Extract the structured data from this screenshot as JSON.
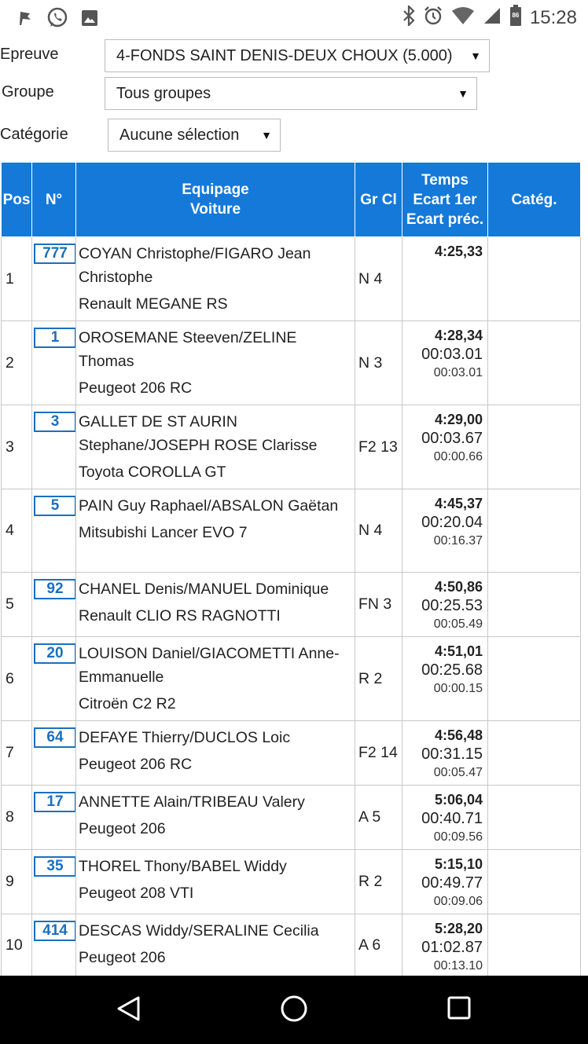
{
  "status_bar": {
    "time": "15:28",
    "battery": "86",
    "left_icons": [
      "flag-icon",
      "whatsapp-icon",
      "image-icon"
    ],
    "right_icons": [
      "bluetooth-icon",
      "alarm-icon",
      "wifi-icon",
      "signal-icon",
      "battery-icon"
    ]
  },
  "filters": {
    "epreuve": {
      "label": "Epreuve",
      "value": "4-FONDS SAINT DENIS-DEUX CHOUX (5.000)"
    },
    "groupe": {
      "label": "Groupe",
      "value": "Tous groupes"
    },
    "categorie": {
      "label": "Catégorie",
      "value": "Aucune sélection"
    }
  },
  "table": {
    "headers": {
      "pos": "Pos",
      "num": "N°",
      "equipage_line1": "Equipage",
      "equipage_line2": "Voiture",
      "grcl": "Gr Cl",
      "temps_line1": "Temps",
      "temps_line2": "Ecart 1er",
      "temps_line3": "Ecart préc.",
      "categ": "Catég."
    },
    "rows": [
      {
        "pos": "1",
        "num": "777",
        "crew": "COYAN Christophe/FIGARO Jean Christophe",
        "car": "Renault MEGANE RS",
        "grcl": "N 4",
        "time": "4:25,33",
        "gap_first": "",
        "gap_prev": "",
        "categ": ""
      },
      {
        "pos": "2",
        "num": "1",
        "crew": "OROSEMANE Steeven/ZELINE Thomas",
        "car": "Peugeot 206 RC",
        "grcl": "N 3",
        "time": "4:28,34",
        "gap_first": "00:03.01",
        "gap_prev": "00:03.01",
        "categ": ""
      },
      {
        "pos": "3",
        "num": "3",
        "crew": "GALLET DE ST AURIN Stephane/JOSEPH ROSE Clarisse",
        "car": "Toyota COROLLA GT",
        "grcl": "F2 13",
        "time": "4:29,00",
        "gap_first": "00:03.67",
        "gap_prev": "00:00.66",
        "categ": ""
      },
      {
        "pos": "4",
        "num": "5",
        "crew": "PAIN Guy Raphael/ABSALON Gaëtan",
        "car": "Mitsubishi Lancer EVO 7",
        "grcl": "N 4",
        "time": "4:45,37",
        "gap_first": "00:20.04",
        "gap_prev": "00:16.37",
        "categ": ""
      },
      {
        "pos": "5",
        "num": "92",
        "crew": "CHANEL Denis/MANUEL Dominique",
        "car": "Renault CLIO RS RAGNOTTI",
        "grcl": "FN 3",
        "time": "4:50,86",
        "gap_first": "00:25.53",
        "gap_prev": "00:05.49",
        "categ": ""
      },
      {
        "pos": "6",
        "num": "20",
        "crew": "LOUISON Daniel/GIACOMETTI Anne-Emmanuelle",
        "car": "Citroën C2 R2",
        "grcl": "R 2",
        "time": "4:51,01",
        "gap_first": "00:25.68",
        "gap_prev": "00:00.15",
        "categ": ""
      },
      {
        "pos": "7",
        "num": "64",
        "crew": "DEFAYE Thierry/DUCLOS Loic",
        "car": "Peugeot 206 RC",
        "grcl": "F2 14",
        "time": "4:56,48",
        "gap_first": "00:31.15",
        "gap_prev": "00:05.47",
        "categ": ""
      },
      {
        "pos": "8",
        "num": "17",
        "crew": "ANNETTE Alain/TRIBEAU Valery",
        "car": "Peugeot 206",
        "grcl": "A 5",
        "time": "5:06,04",
        "gap_first": "00:40.71",
        "gap_prev": "00:09.56",
        "categ": ""
      },
      {
        "pos": "9",
        "num": "35",
        "crew": "THOREL Thony/BABEL Widdy",
        "car": "Peugeot 208 VTI",
        "grcl": "R 2",
        "time": "5:15,10",
        "gap_first": "00:49.77",
        "gap_prev": "00:09.06",
        "categ": ""
      },
      {
        "pos": "10",
        "num": "414",
        "crew": "DESCAS Widdy/SERALINE Cecilia",
        "car": "Peugeot 206",
        "grcl": "A 6",
        "time": "5:28,20",
        "gap_first": "01:02.87",
        "gap_prev": "00:13.10",
        "categ": ""
      }
    ]
  },
  "nav_bar": {
    "buttons": [
      "back-icon",
      "home-icon",
      "recents-icon"
    ]
  },
  "colors": {
    "header_blue": "#1479d9",
    "number_box": "#1a6fc0",
    "nav_bar": "#000000"
  }
}
